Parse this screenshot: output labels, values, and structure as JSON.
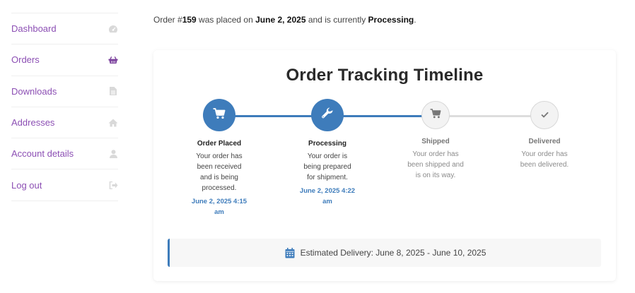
{
  "sidebar": {
    "items": [
      {
        "label": "Dashboard",
        "icon": "dashboard-gauge-icon"
      },
      {
        "label": "Orders",
        "icon": "basket-icon"
      },
      {
        "label": "Downloads",
        "icon": "file-icon"
      },
      {
        "label": "Addresses",
        "icon": "home-icon"
      },
      {
        "label": "Account details",
        "icon": "user-icon"
      },
      {
        "label": "Log out",
        "icon": "sign-out-icon"
      }
    ]
  },
  "summary": {
    "prefix": "Order #",
    "order_number": "159",
    "mid1": " was placed on ",
    "date": "June 2, 2025",
    "mid2": " and is currently ",
    "status": "Processing",
    "suffix": "."
  },
  "card": {
    "title": "Order Tracking Timeline",
    "steps": [
      {
        "label": "Order Placed",
        "description": "Your order has been received and is being processed.",
        "date": "June 2, 2025 4:15 am",
        "state": "completed",
        "icon": "cart-icon"
      },
      {
        "label": "Processing",
        "description": "Your order is being prepared for shipment.",
        "date": "June 2, 2025 4:22 am",
        "state": "completed",
        "icon": "wrench-icon"
      },
      {
        "label": "Shipped",
        "description": "Your order has been shipped and is on its way.",
        "date": "",
        "state": "pending",
        "icon": "cart-icon"
      },
      {
        "label": "Delivered",
        "description": "Your order has been delivered.",
        "date": "",
        "state": "pending",
        "icon": "check-icon"
      }
    ],
    "estimated_delivery": "Estimated Delivery: June 8, 2025 - June 10, 2025"
  },
  "colors": {
    "accent": "#3e7cbb",
    "nav_link": "#8c4fb4",
    "pending_track": "#dddddd"
  }
}
